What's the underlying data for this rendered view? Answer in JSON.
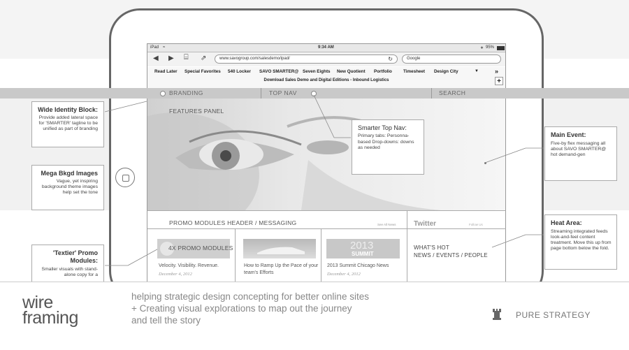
{
  "status_bar": {
    "device": "iPad",
    "time": "9:34 AM",
    "battery": "95%"
  },
  "browser": {
    "url": "www.savogroup.com/salesdemo/ipad/",
    "search_value": "Google",
    "bookmarks": [
      "Read Later",
      "Special Favorites",
      "540 Locker",
      "SAVO SMARTER@",
      "Seven Eights",
      "New Quotient",
      "Portfolio",
      "Timesheet",
      "Design City"
    ],
    "download_text": "Download Sales Demo and Digital Editions - Inbound Logistics",
    "overflow": "»",
    "add": "+"
  },
  "nav": {
    "branding": "BRANDING",
    "top_nav": "TOP NAV",
    "search": "SEARCH"
  },
  "hero": {
    "features_panel": "FEATURES PANEL"
  },
  "callouts": {
    "smarter_top_nav": {
      "title": "Smarter Top Nav:",
      "body": "Primary tabs: Personna-based Drop-downs: downs as needed"
    },
    "wide_identity": {
      "title": "Wide Identity Block:",
      "body": "Provide added lateral space for 'SMARTER' tagline to be unified as part of branding"
    },
    "mega_bkgd": {
      "title": "Mega Bkgd Images",
      "body": "Vague, yet inspiring background theme images help set the tone"
    },
    "textier_promo": {
      "title": "'Textier' Promo Modules:",
      "body": "Smaller visuals with stand-alone copy for a"
    },
    "main_event": {
      "title": "Main Event:",
      "body": "Five-by flex messaging all about SAVO SMARTER@ hot demand-gen"
    },
    "heat_area": {
      "title": "Heat Area:",
      "body": "Streaming integrated feeds look-and-feel content treatment. Move this up from page bottom below the fold."
    }
  },
  "promo": {
    "header": "PROMO MODULES HEADER / MESSAGING",
    "header_link": "See All News",
    "badge": "4X PROMO MODULES",
    "modules": [
      {
        "title": "Velocity. Visibility. Revenue.",
        "date": "December 4, 2012"
      },
      {
        "title": "How to Ramp Up the Pace of your team's Efforts",
        "date": ""
      },
      {
        "title": "2013 Summit Chicago News",
        "date": "December 4, 2012"
      }
    ],
    "summit_year": "2013",
    "summit_word": "SUMMIT"
  },
  "twitter": {
    "title": "Twitter",
    "follow": "Follow Us",
    "whats_hot": "WHAT'S HOT",
    "feeds": "NEWS / EVENTS / PEOPLE"
  },
  "footer": {
    "wordmark_line1": "wire",
    "wordmark_line2": "framing",
    "tagline": "helping strategic design concepting for better online sites + Creating visual explorations to map out the journey and tell the story",
    "brand": "PURE STRATEGY"
  }
}
